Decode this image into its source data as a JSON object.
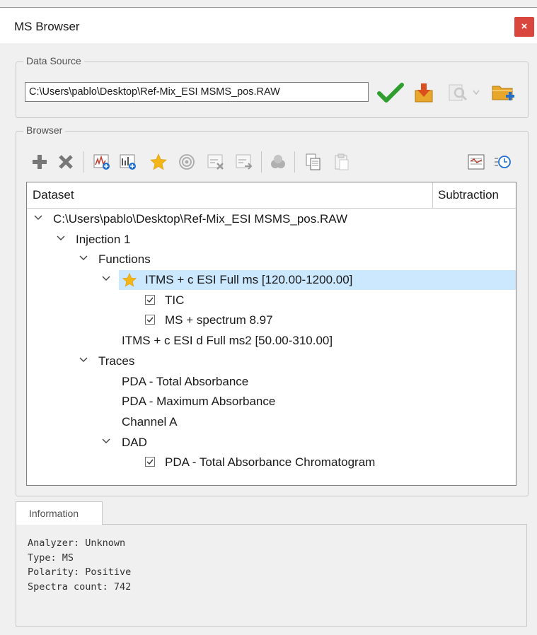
{
  "window": {
    "title": "MS Browser",
    "close_icon": "×"
  },
  "data_source": {
    "legend": "Data Source",
    "path_value": "C:\\Users\\pablo\\Desktop\\Ref-Mix_ESI MSMS_pos.RAW",
    "icons": [
      "checkmark-icon",
      "download-icon",
      "inspect-icon",
      "dropdown-arrow-icon",
      "add-folder-icon"
    ],
    "colors": {
      "check": "#2f9e2f",
      "download": "#d9501e",
      "folder": "#e8a72a",
      "add": "#1f6fd1"
    }
  },
  "browser": {
    "legend": "Browser",
    "toolbar_icons": [
      "add-icon",
      "remove-icon",
      "add-spectrum-icon",
      "add-chromatogram-icon",
      "favorite-star-icon",
      "target-icon",
      "remove-trace-icon",
      "export-trace-icon",
      "group-icon",
      "copy-icon",
      "paste-icon",
      "properties-icon",
      "time-settings-icon"
    ],
    "columns": [
      "Dataset",
      "Subtraction"
    ],
    "tree": {
      "root": "C:\\Users\\pablo\\Desktop\\Ref-Mix_ESI MSMS_pos.RAW",
      "injection": "Injection 1",
      "functions": "Functions",
      "function_1": "ITMS + c ESI Full ms [120.00-1200.00]",
      "tic": "TIC",
      "ms_spectrum": "MS + spectrum 8.97",
      "function_2": "ITMS + c ESI d Full ms2 [50.00-310.00]",
      "traces": "Traces",
      "trace_1": "PDA - Total Absorbance",
      "trace_2": "PDA - Maximum Absorbance",
      "trace_3": "Channel A",
      "dad": "DAD",
      "dad_child": "PDA - Total Absorbance Chromatogram"
    },
    "selection_color": "#cce8ff"
  },
  "information": {
    "tab": "Information",
    "analyzer": "Analyzer: Unknown",
    "type": "Type: MS",
    "polarity": "Polarity: Positive",
    "spectra_count": "Spectra count: 742"
  }
}
